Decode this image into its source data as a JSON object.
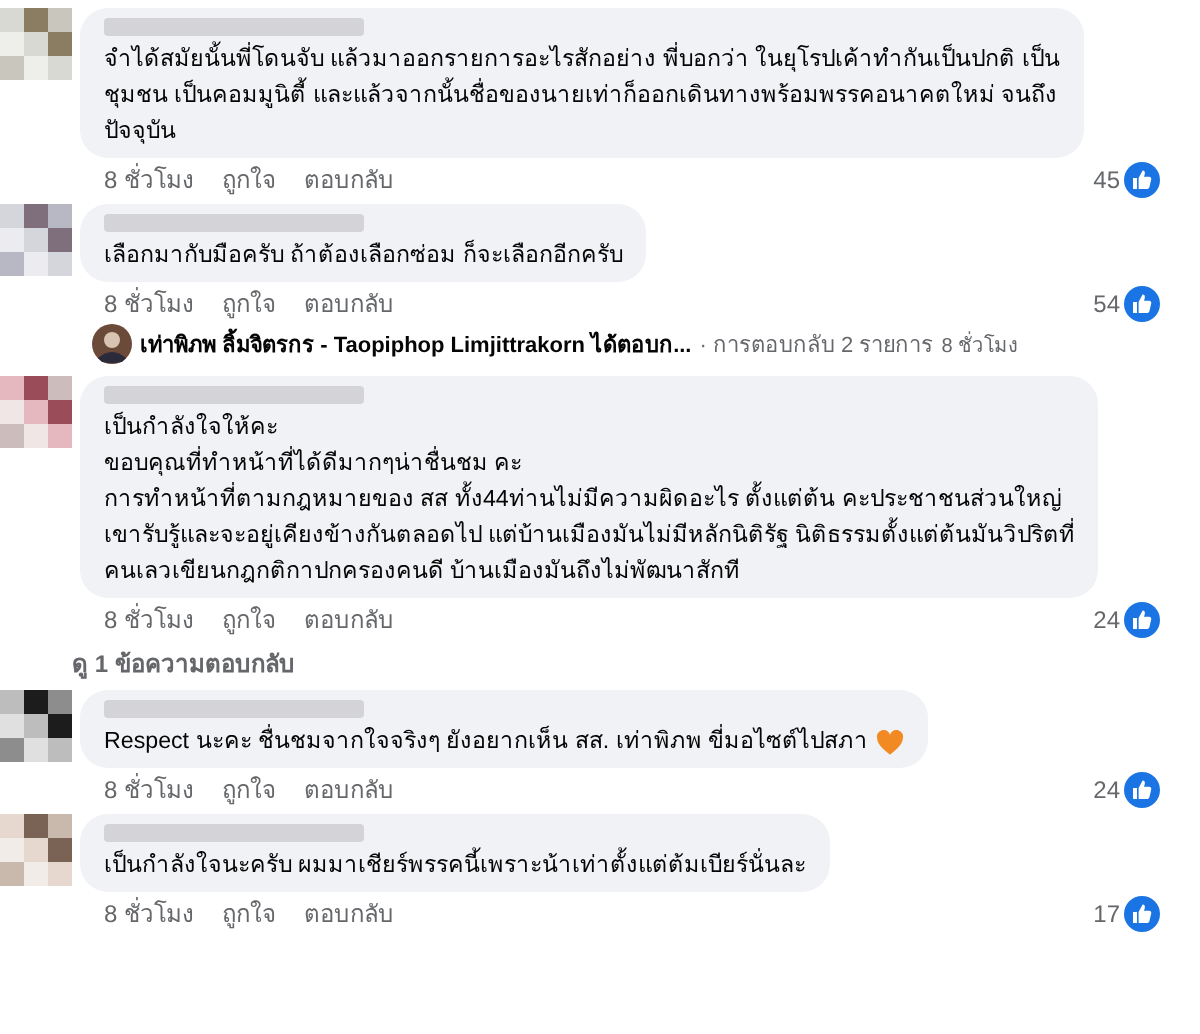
{
  "comments": [
    {
      "lines": [
        "จำได้สมัยนั้นพี่โดนจับ แล้วมาออกรายการอะไรสักอย่าง พี่บอกว่า ในยุโรปเค้าทำกันเป็นปกติ เป็น",
        "ชุมชน เป็นคอมมูนิตี้ และแล้วจากนั้นชื่อของนายเท่าก็ออกเดินทางพร้อมพรรคอนาคตใหม่ จนถึง",
        "ปัจจุบัน"
      ],
      "heart": false,
      "time": "8 ชั่วโมง",
      "like": "ถูกใจ",
      "reply": "ตอบกลับ",
      "likes": "45"
    },
    {
      "lines": [
        "เลือกมากับมือครับ ถ้าต้องเลือกซ่อม ก็จะเลือกอีกครับ"
      ],
      "heart": false,
      "time": "8 ชั่วโมง",
      "like": "ถูกใจ",
      "reply": "ตอบกลับ",
      "likes": "54",
      "reply_preview": {
        "text": "เท่าพิภพ ลิ้มจิตรกร - Taopiphop Limjittrakorn ได้ตอบก...",
        "count": "· การตอบกลับ 2 รายการ",
        "time": "8 ชั่วโมง"
      }
    },
    {
      "lines": [
        "เป็นกำลังใจให้คะ",
        "ขอบคุณที่ทำหน้าที่ได้ดีมากๆน่าชื่นชม คะ",
        "การทำหน้าที่ตามกฎหมายของ สส ทั้ง44ท่านไม่มีความผิดอะไร ตั้งแต่ต้น คะประชาชนส่วนใหญ่",
        "เขารับรู้และจะอยู่เคียงข้างกันตลอดไป แต่บ้านเมืองมันไม่มีหลักนิติรัฐ นิติธรรมตั้งแต่ต้นมันวิปริตที่",
        "คนเลวเขียนกฎกติกาปกครองคนดี บ้านเมืองมันถึงไม่พัฒนาสักที"
      ],
      "heart": false,
      "time": "8 ชั่วโมง",
      "like": "ถูกใจ",
      "reply": "ตอบกลับ",
      "likes": "24",
      "view_replies": "ดู 1 ข้อความตอบกลับ"
    },
    {
      "lines": [
        "Respect นะคะ ชื่นชมจากใจจริงๆ ยังอยากเห็น สส. เท่าพิภพ ขี่มอไซต์ไปสภา"
      ],
      "heart": true,
      "time": "8 ชั่วโมง",
      "like": "ถูกใจ",
      "reply": "ตอบกลับ",
      "likes": "24"
    },
    {
      "lines": [
        "เป็นกำลังใจนะครับ ผมมาเชียร์พรรคนี้เพราะน้าเท่าตั้งแต่ต้มเบียร์นั่นละ"
      ],
      "heart": false,
      "time": "8 ชั่วโมง",
      "like": "ถูกใจ",
      "reply": "ตอบกลับ",
      "likes": "17"
    }
  ]
}
